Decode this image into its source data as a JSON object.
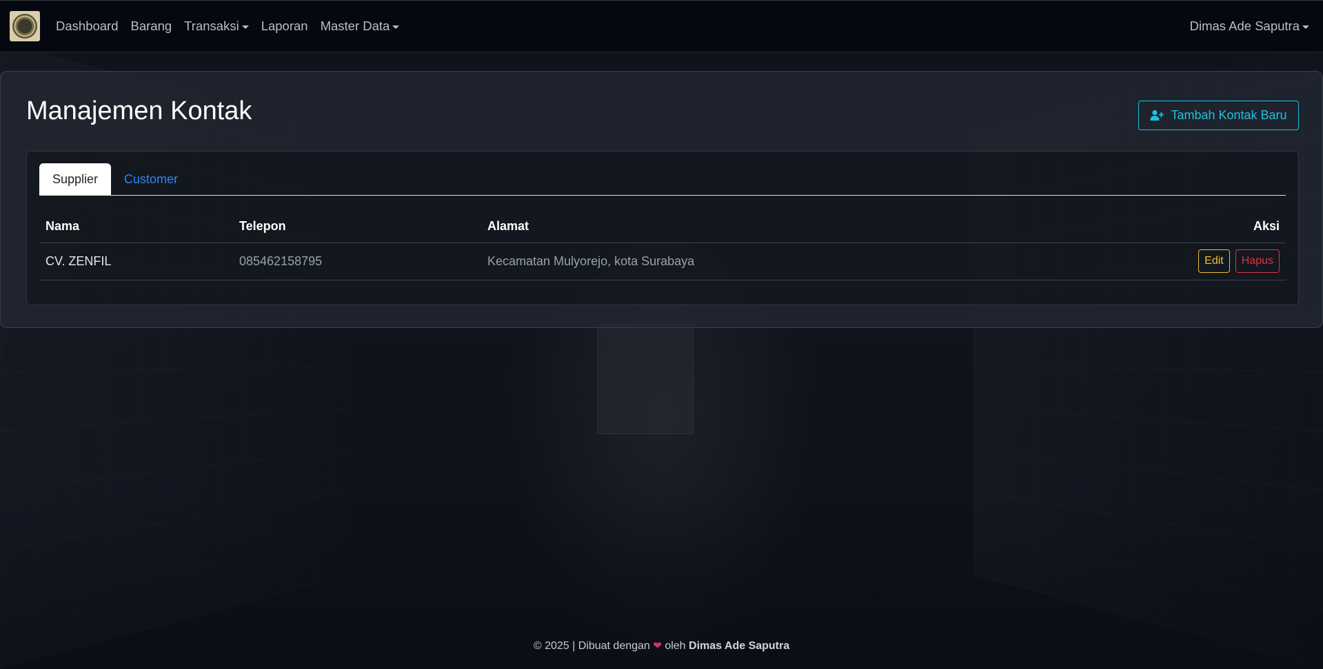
{
  "navbar": {
    "logo_icon": "warehouse-seal-logo",
    "items": [
      {
        "label": "Dashboard",
        "dropdown": false
      },
      {
        "label": "Barang",
        "dropdown": false
      },
      {
        "label": "Transaksi",
        "dropdown": true
      },
      {
        "label": "Laporan",
        "dropdown": false
      },
      {
        "label": "Master Data",
        "dropdown": true
      }
    ],
    "user": "Dimas Ade Saputra"
  },
  "page": {
    "title": "Manajemen Kontak",
    "add_button_label": "Tambah Kontak Baru",
    "add_button_icon": "person-plus-icon"
  },
  "tabs": [
    {
      "label": "Supplier",
      "active": true
    },
    {
      "label": "Customer",
      "active": false
    }
  ],
  "table": {
    "headers": [
      "Nama",
      "Telepon",
      "Alamat",
      "Aksi"
    ],
    "rows": [
      {
        "nama": "CV. ZENFIL",
        "telepon": "085462158795",
        "alamat": "Kecamatan Mulyorejo, kota Surabaya",
        "edit_label": "Edit",
        "delete_label": "Hapus"
      }
    ]
  },
  "footer": {
    "prefix": "© 2025 | Dibuat dengan",
    "heart": "❤",
    "by": "oleh",
    "author": "Dimas Ade Saputra"
  },
  "colors": {
    "accent_info": "#1ec1e0",
    "link": "#2e86f2",
    "warning": "#f2c12e",
    "danger": "#dc3545"
  }
}
